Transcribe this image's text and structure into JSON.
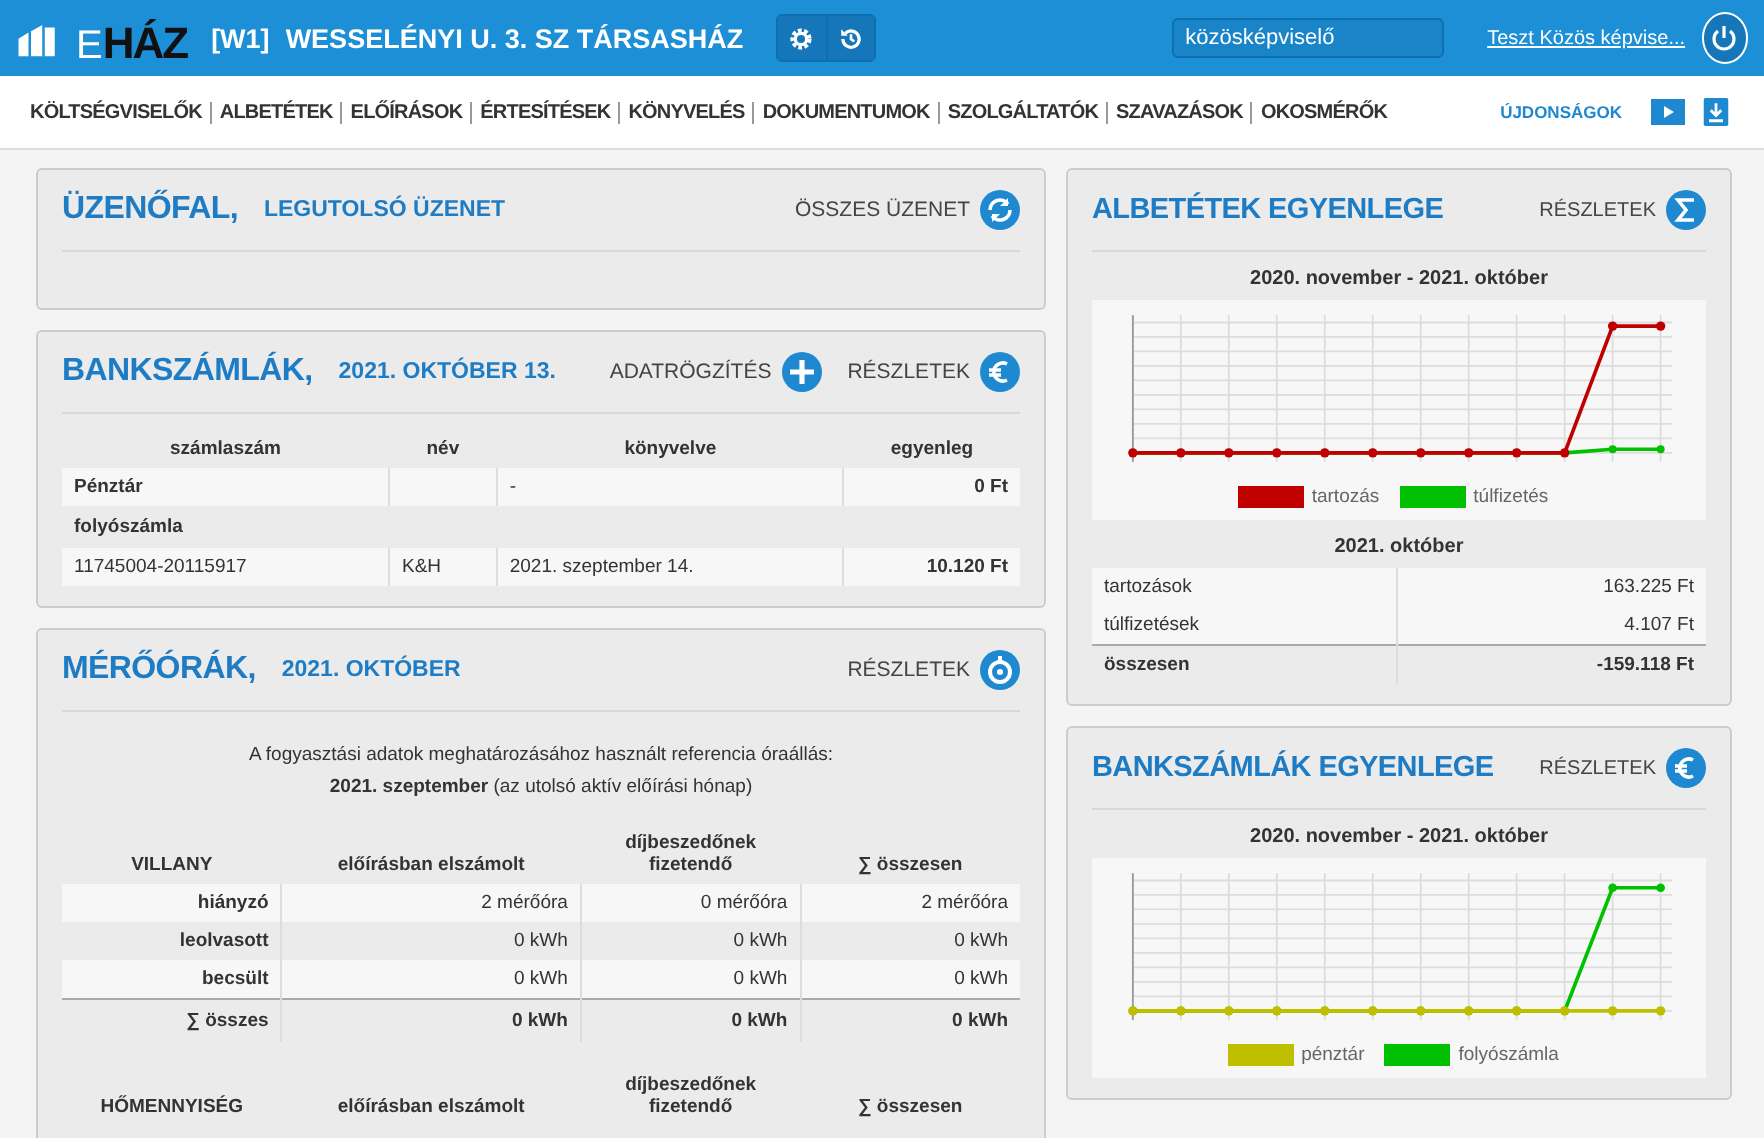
{
  "header": {
    "logo_letter": "E",
    "logo_name": "HÁZ",
    "code": "[W1]",
    "title": "WESSELÉNYI U. 3. SZ TÁRSASHÁZ",
    "role_field": "közösképviselő",
    "user_link": "Teszt Közös képvise..."
  },
  "nav": {
    "items": [
      "KÖLTSÉGVISELŐK",
      "ALBETÉTEK",
      "ELŐÍRÁSOK",
      "ÉRTESÍTÉSEK",
      "KÖNYVELÉS",
      "DOKUMENTUMOK",
      "SZOLGÁLTATÓK",
      "SZAVAZÁSOK",
      "OKOSMÉRŐK"
    ],
    "news": "ÚJDONSÁGOK"
  },
  "message_wall": {
    "title": "ÜZENŐFAL,",
    "subtitle": "LEGUTOLSÓ ÜZENET",
    "action": "ÖSSZES ÜZENET"
  },
  "bank_accounts": {
    "title": "BANKSZÁMLÁK,",
    "subtitle": "2021. OKTÓBER 13.",
    "actions": [
      {
        "label": "ADATRÖGZÍTÉS",
        "kind": "plus"
      },
      {
        "label": "RÉSZLETEK",
        "kind": "euro"
      }
    ],
    "columns": [
      "számlaszám",
      "név",
      "könyvelve",
      "egyenleg"
    ],
    "rows": [
      {
        "kind": "row",
        "cells": [
          "Pénztár",
          "",
          "-",
          "0 Ft"
        ]
      },
      {
        "kind": "group",
        "cells": [
          "folyószámla"
        ]
      },
      {
        "kind": "row",
        "cells": [
          "11745004-20115917",
          "K&H",
          "2021. szeptember 14.",
          "10.120 Ft"
        ]
      }
    ]
  },
  "meters": {
    "title": "MÉRŐÓRÁK,",
    "subtitle": "2021. OKTÓBER",
    "action": "RÉSZLETEK",
    "note_line1": "A fogyasztási adatok meghatározásához használt referencia óraállás:",
    "note_bold": "2021. szeptember",
    "note_rest": "(az utolsó aktív előírási hónap)",
    "tables": [
      {
        "columns": [
          "VILLANY",
          "előírásban elszámolt",
          "díjbeszedőnek fizetendő",
          "∑ összesen"
        ],
        "rows": [
          {
            "cells": [
              "hiányzó",
              "2 mérőóra",
              "0 mérőóra",
              "2 mérőóra"
            ]
          },
          {
            "cells": [
              "leolvasott",
              "0 kWh",
              "0 kWh",
              "0 kWh"
            ]
          },
          {
            "cells": [
              "becsült",
              "0 kWh",
              "0 kWh",
              "0 kWh"
            ]
          }
        ],
        "total": [
          "∑ összes",
          "0 kWh",
          "0 kWh",
          "0 kWh"
        ]
      },
      {
        "columns": [
          "HŐMENNYISÉG",
          "előírásban elszámolt",
          "díjbeszedőnek fizetendő",
          "∑ összesen"
        ]
      }
    ]
  },
  "unit_balance": {
    "title": "ALBETÉTEK EGYENLEGE",
    "action": "RÉSZLETEK",
    "chart_title": "2020. november - 2021. október",
    "legend": [
      {
        "label": "tartozás",
        "color": "#c00000"
      },
      {
        "label": "túlfizetés",
        "color": "#00c000"
      }
    ],
    "month": "2021. október",
    "rows": [
      {
        "label": "tartozások",
        "value": "163.225 Ft"
      },
      {
        "label": "túlfizetések",
        "value": "4.107 Ft"
      }
    ],
    "total": {
      "label": "összesen",
      "value": "-159.118 Ft"
    }
  },
  "bank_balance": {
    "title": "BANKSZÁMLÁK EGYENLEGE",
    "action": "RÉSZLETEK",
    "chart_title": "2020. november - 2021. október",
    "legend": [
      {
        "label": "pénztár",
        "color": "#bfbf00"
      },
      {
        "label": "folyószámla",
        "color": "#00c000"
      }
    ]
  }
}
